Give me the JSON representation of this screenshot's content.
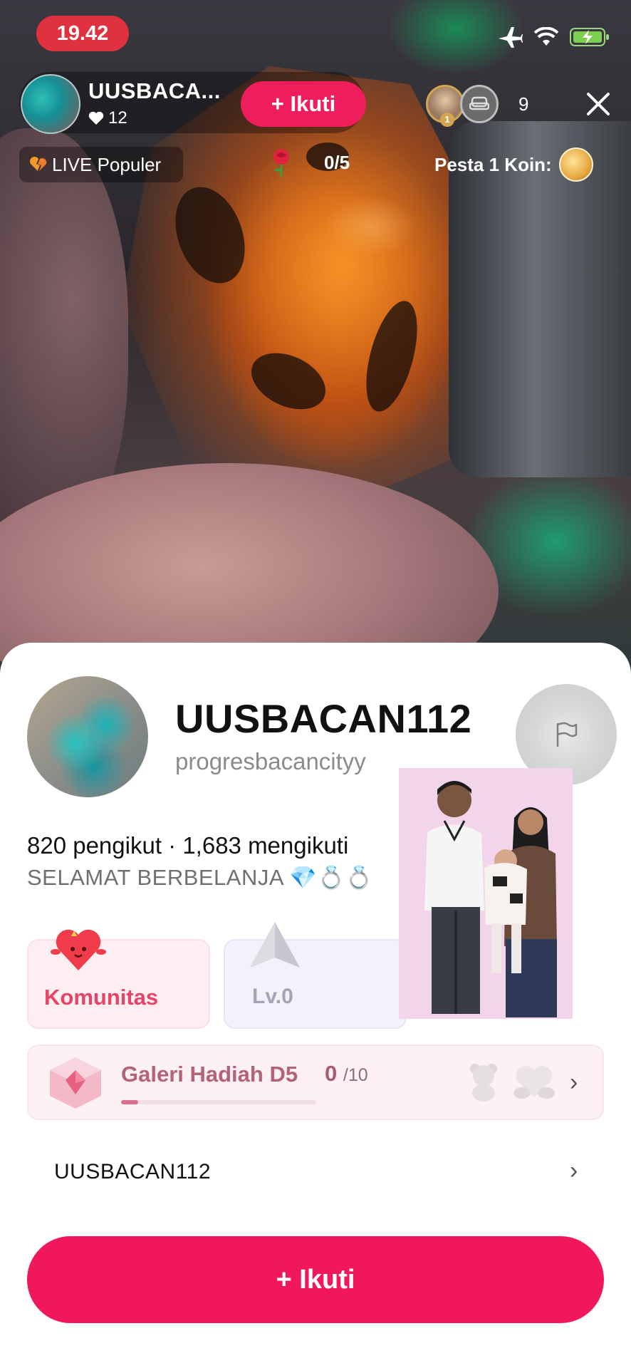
{
  "status_bar": {
    "time": "19.42"
  },
  "live": {
    "host_name": "UUSBACA...",
    "likes": "12",
    "follow_label": "+ Ikuti",
    "viewer_count": "9",
    "top_viewer_rank": "1",
    "popular_label": "LIVE Populer",
    "rose_progress": "0/5",
    "party_label": "Pesta 1 Koin:"
  },
  "profile": {
    "display_name": "UUSBACAN112",
    "username": "progresbacancityy",
    "stats": "820 pengikut · 1,683 mengikuti",
    "bio": "SELAMAT BERBELANJA 💎💍💍"
  },
  "badges": {
    "community_label": "Komunitas",
    "level_label": "Lv.0"
  },
  "gallery": {
    "title": "Galeri Hadiah D5",
    "current": "0",
    "total": "/10",
    "progress_fraction": 0.0
  },
  "name_row": {
    "label": "UUSBACAN112"
  },
  "follow_button": {
    "label": "+ Ikuti"
  },
  "colors": {
    "accent": "#f0175a",
    "time_pill": "#e0313e"
  }
}
